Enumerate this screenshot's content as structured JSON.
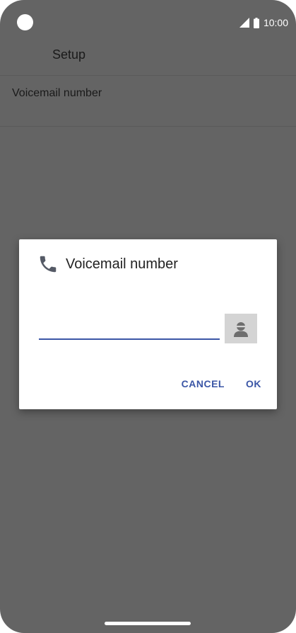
{
  "status_bar": {
    "time": "10:00",
    "icons": [
      "signal-icon",
      "battery-icon"
    ]
  },
  "app_bar": {
    "title": "Setup"
  },
  "settings": {
    "row_label": "Voicemail number"
  },
  "dialog": {
    "title": "Voicemail number",
    "title_icon": "phone-icon",
    "input_value": "",
    "contact_icon": "contact-icon",
    "cancel_label": "CANCEL",
    "ok_label": "OK"
  },
  "colors": {
    "overlay_background": "#646464",
    "accent": "#3b56a6",
    "dialog_background": "#ffffff"
  }
}
